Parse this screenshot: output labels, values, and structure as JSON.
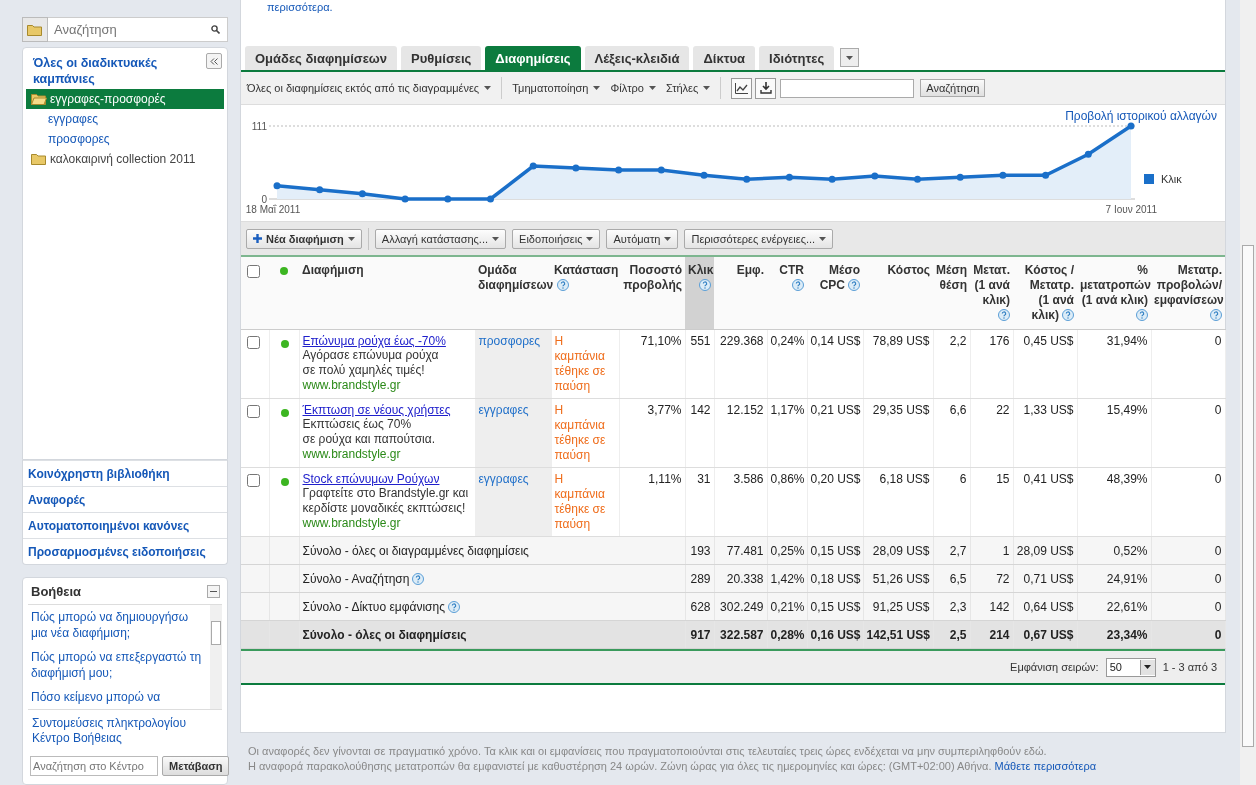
{
  "top_text": "περισσότερα.",
  "sidebar": {
    "search": {
      "placeholder": "Αναζήτηση"
    },
    "tree": {
      "title": "Όλες οι διαδικτυακές καμπάνιες",
      "items": [
        {
          "label": "εγγραφες-προσφορές",
          "selected": true,
          "expanded": true,
          "children": [
            {
              "label": "εγγραφες",
              "selected": false
            },
            {
              "label": "προσφορες",
              "selected": false
            }
          ]
        },
        {
          "label": "καλοκαιρινή collection 2011",
          "selected": false,
          "expanded": false
        }
      ]
    },
    "links": [
      "Κοινόχρηστη βιβλιοθήκη",
      "Αναφορές",
      "Αυτοματοποιημένοι κανόνες",
      "Προσαρμοσμένες ειδοποιήσεις"
    ],
    "help": {
      "title": "Βοήθεια",
      "items": [
        "Πώς μπορώ να δημιουργήσω μια νέα διαφήμιση;",
        "Πώς μπορώ να επεξεργαστώ τη διαφήμισή μου;",
        "Πόσο κείμενο μπορώ να"
      ],
      "links": [
        "Συντομεύσεις πληκτρολογίου",
        "Κέντρο Βοήθειας"
      ],
      "search_placeholder": "Αναζήτηση στο Κέντρο",
      "button": "Μετάβαση"
    }
  },
  "tabs": [
    {
      "label": "Ομάδες διαφημίσεων",
      "selected": false
    },
    {
      "label": "Ρυθμίσεις",
      "selected": false
    },
    {
      "label": "Διαφημίσεις",
      "selected": true
    },
    {
      "label": "Λέξεις-κλειδιά",
      "selected": false
    },
    {
      "label": "Δίκτυα",
      "selected": false
    },
    {
      "label": "Ιδιότητες",
      "selected": false
    }
  ],
  "toolbar": {
    "dropdowns": [
      "Όλες οι διαφημίσεις εκτός από τις διαγραμμένες",
      "Τμηματοποίηση",
      "Φίλτρο",
      "Στήλες"
    ],
    "search_button": "Αναζήτηση"
  },
  "chart_link": "Προβολή ιστορικού αλλαγών",
  "chart_data": {
    "type": "area",
    "categories": [
      "18 Μαΐ 2011",
      null,
      null,
      null,
      null,
      null,
      null,
      null,
      null,
      null,
      null,
      null,
      null,
      null,
      null,
      null,
      null,
      null,
      null,
      null,
      "7 Ιουν 2011"
    ],
    "series": [
      {
        "name": "Κλικ",
        "color": "#1a6fc9",
        "values": [
          20,
          14,
          8,
          0,
          0,
          0,
          50,
          47,
          44,
          44,
          36,
          30,
          33,
          30,
          35,
          30,
          33,
          36,
          36,
          68,
          111
        ]
      }
    ],
    "ylim": [
      0,
      111
    ],
    "yticks": [
      0,
      111
    ]
  },
  "actions": [
    {
      "label": "Νέα διαφήμιση",
      "kind": "primary"
    },
    {
      "label": "Αλλαγή κατάστασης...",
      "kind": "menu"
    },
    {
      "label": "Ειδοποιήσεις",
      "kind": "menu"
    },
    {
      "label": "Αυτόματη",
      "kind": "menu"
    },
    {
      "label": "Περισσότερες ενέργειες...",
      "kind": "menu"
    }
  ],
  "table": {
    "header_checkbox": {
      "checked": false
    },
    "columns": [
      {
        "label": "Διαφήμιση",
        "help": false,
        "sorted": false
      },
      {
        "label": "Ομάδα διαφημίσεων",
        "help": false,
        "sorted": false
      },
      {
        "label": "Κατάσταση",
        "help": true,
        "sorted": false
      },
      {
        "label": "Ποσοστό προβολής",
        "help": false,
        "sorted": false
      },
      {
        "label": "Κλικ",
        "help": true,
        "sorted": true
      },
      {
        "label": "Εμφ.",
        "help": false,
        "sorted": false
      },
      {
        "label": "CTR",
        "help": true,
        "sorted": false
      },
      {
        "label": "Μέσο CPC",
        "help": true,
        "sorted": false
      },
      {
        "label": "Κόστος",
        "help": false,
        "sorted": false
      },
      {
        "label": "Μέση θέση",
        "help": false,
        "sorted": false
      },
      {
        "label": "Μετατ. (1 ανά κλικ)",
        "help": true,
        "sorted": false
      },
      {
        "label": "Κόστος / Μετατρ. (1 ανά κλικ)",
        "help": true,
        "sorted": false
      },
      {
        "label": "% μετατροπών (1 ανά κλικ)",
        "help": true,
        "sorted": false
      },
      {
        "label": "Μετατρ. προβολών/ εμφανίσεων",
        "help": true,
        "sorted": false
      }
    ],
    "rows": [
      {
        "checked": false,
        "active": true,
        "headline": "Επώνυμα ρούχα έως -70%",
        "line1": "Αγόρασε επώνυμα ρούχα",
        "line2": "σε πολύ χαμηλές τιμές!",
        "url": "www.brandstyle.gr",
        "group": "προσφορες",
        "status": "Η καμπάνια τέθηκε σε παύση",
        "values": [
          "71,10%",
          "551",
          "229.368",
          "0,24%",
          "0,14 US$",
          "78,89 US$",
          "2,2",
          "176",
          "0,45 US$",
          "31,94%",
          "0"
        ]
      },
      {
        "checked": false,
        "active": true,
        "headline": "Έκπτωση σε νέους χρήστες",
        "line1": "Εκπτώσεις έως 70%",
        "line2": "σε ρούχα και παπούτσια.",
        "url": "www.brandstyle.gr",
        "group": "εγγραφες",
        "status": "Η καμπάνια τέθηκε σε παύση",
        "values": [
          "3,77%",
          "142",
          "12.152",
          "1,17%",
          "0,21 US$",
          "29,35 US$",
          "6,6",
          "22",
          "1,33 US$",
          "15,49%",
          "0"
        ]
      },
      {
        "checked": false,
        "active": true,
        "headline": "Stock επώνυμων Ρούχων",
        "line1": "Γραφτείτε στο Brandstyle.gr και",
        "line2": "κερδίστε μοναδικές εκπτώσεις!",
        "url": "www.brandstyle.gr",
        "group": "εγγραφες",
        "status": "Η καμπάνια τέθηκε σε παύση",
        "values": [
          "1,11%",
          "31",
          "3.586",
          "0,86%",
          "0,20 US$",
          "6,18 US$",
          "6",
          "15",
          "0,41 US$",
          "48,39%",
          "0"
        ]
      }
    ],
    "totals": [
      {
        "label": "Σύνολο - όλες οι διαγραμμένες διαφημίσεις",
        "help": false,
        "kind": "subtotal",
        "values": [
          "193",
          "77.481",
          "0,25%",
          "0,15 US$",
          "28,09 US$",
          "2,7",
          "1",
          "28,09 US$",
          "0,52%",
          "0"
        ]
      },
      {
        "label": "Σύνολο - Αναζήτηση",
        "help": true,
        "kind": "subtotal",
        "values": [
          "289",
          "20.338",
          "1,42%",
          "0,18 US$",
          "51,26 US$",
          "6,5",
          "72",
          "0,71 US$",
          "24,91%",
          "0"
        ]
      },
      {
        "label": "Σύνολο - Δίκτυο εμφάνισης",
        "help": true,
        "kind": "subtotal",
        "values": [
          "628",
          "302.249",
          "0,21%",
          "0,15 US$",
          "91,25 US$",
          "2,3",
          "142",
          "0,64 US$",
          "22,61%",
          "0"
        ]
      },
      {
        "label": "Σύνολο - όλες οι διαφημίσεις",
        "help": false,
        "kind": "grand",
        "values": [
          "917",
          "322.587",
          "0,28%",
          "0,16 US$",
          "142,51 US$",
          "2,5",
          "214",
          "0,67 US$",
          "23,34%",
          "0"
        ]
      }
    ]
  },
  "pagination": {
    "label": "Εμφάνιση σειρών:",
    "value": "50",
    "range": "1 - 3 από 3"
  },
  "footer": {
    "line1": "Οι αναφορές δεν γίνονται σε πραγματικό χρόνο. Τα κλικ και οι εμφανίσεις που πραγματοποιούνται στις τελευταίες τρεις ώρες ενδέχεται να μην συμπεριληφθούν εδώ.",
    "line2": "Η αναφορά παρακολούθησης μετατροπών θα εμφανιστεί με καθυστέρηση 24 ωρών. Ζώνη ώρας για όλες τις ημερομηνίες και ώρες: (GMT+02:00) Αθήνα.",
    "link": "Μάθετε περισσότερα"
  }
}
